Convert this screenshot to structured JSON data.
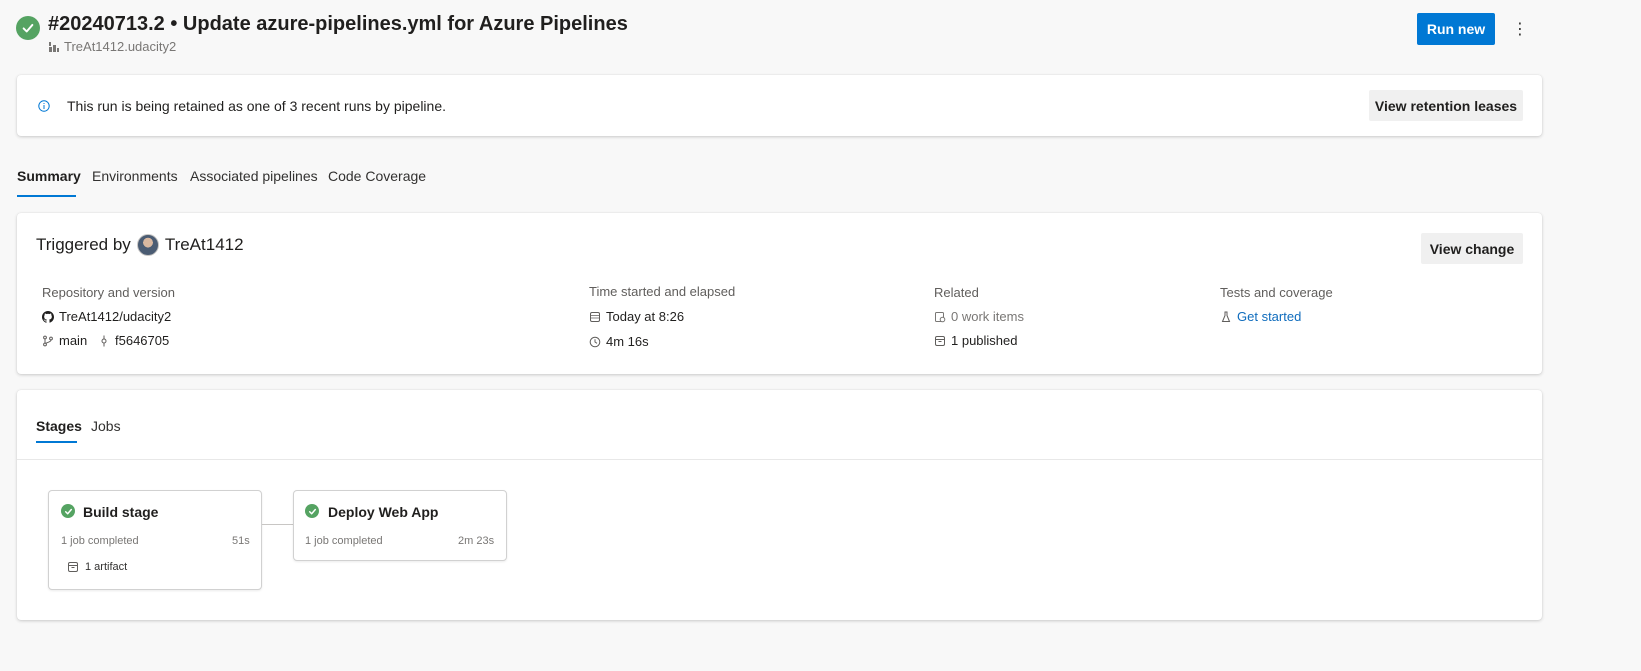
{
  "header": {
    "title": "#20240713.2 • Update azure-pipelines.yml for Azure Pipelines",
    "repo": "TreAt1412.udacity2",
    "run_new_label": "Run new",
    "more_label": "⋮",
    "status_color": "#55a362"
  },
  "retention": {
    "message": "This run is being retained as one of 3 recent runs by pipeline.",
    "button_label": "View retention leases"
  },
  "tabs": [
    {
      "label": "Summary",
      "active": true
    },
    {
      "label": "Environments",
      "active": false
    },
    {
      "label": "Associated pipelines",
      "active": false
    },
    {
      "label": "Code Coverage",
      "active": false
    }
  ],
  "summary": {
    "triggered_by_label": "Triggered by",
    "user": "TreAt1412",
    "view_change_label": "View change",
    "repository": {
      "label": "Repository and version",
      "repo": "TreAt1412/udacity2",
      "branch": "main",
      "commit": "f5646705"
    },
    "time": {
      "label": "Time started and elapsed",
      "started": "Today at 8:26",
      "elapsed": "4m 16s"
    },
    "related": {
      "label": "Related",
      "work_items": "0 work items",
      "published": "1 published"
    },
    "tests": {
      "label": "Tests and coverage",
      "link": "Get started"
    }
  },
  "stages_section": {
    "tabs": [
      {
        "label": "Stages",
        "active": true
      },
      {
        "label": "Jobs",
        "active": false
      }
    ],
    "stages": [
      {
        "name": "Build stage",
        "jobs": "1 job completed",
        "duration": "51s",
        "artifact": "1 artifact"
      },
      {
        "name": "Deploy Web App",
        "jobs": "1 job completed",
        "duration": "2m 23s"
      }
    ]
  },
  "colors": {
    "accent": "#0078d4",
    "success": "#55a362"
  }
}
